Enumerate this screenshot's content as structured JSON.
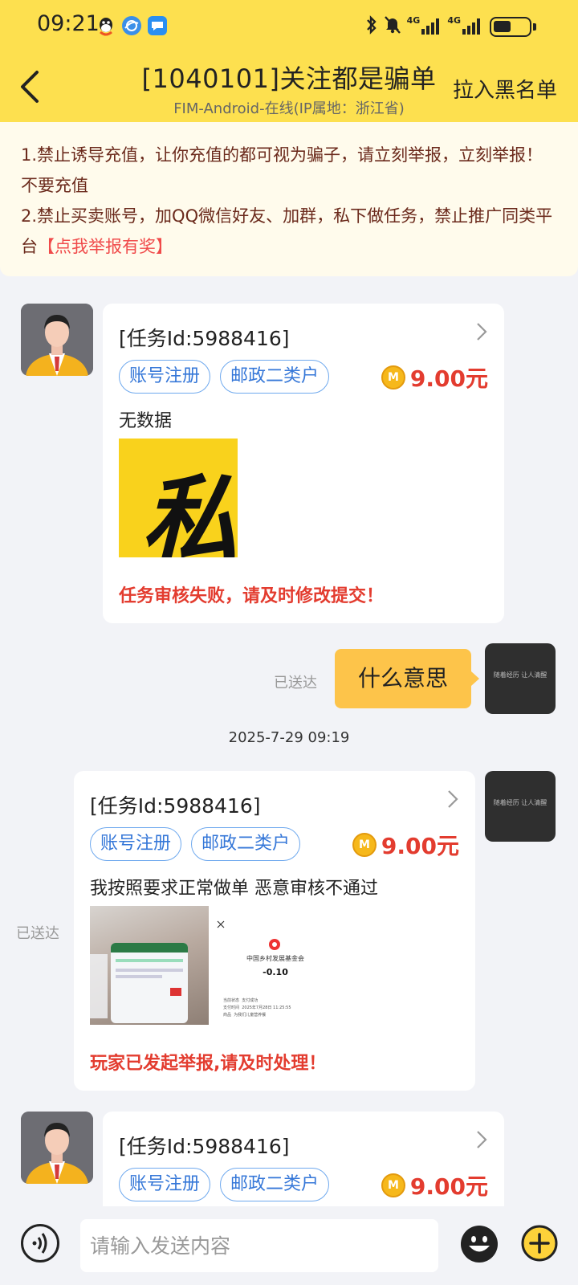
{
  "status_bar": {
    "time": "09:21",
    "network_label": "4G",
    "battery_level": 0.5,
    "icons": [
      "qq-icon",
      "browser-icon",
      "chat-app-icon",
      "bluetooth-icon",
      "mute-icon",
      "signal-icon",
      "battery-icon"
    ]
  },
  "header": {
    "title": "[1040101]关注都是骗单",
    "subtitle": "FIM-Android-在线(IP属地：浙江省)",
    "blacklist_label": "拉入黑名单"
  },
  "notice": {
    "line1": "1.禁止诱导充值，让你充值的都可视为骗子，请立刻举报，立刻举报！不要充值",
    "line2": "2.禁止买卖账号，加QQ微信好友、加群，私下做任务，禁止推广同类平台",
    "report_link": "【点我举报有奖】"
  },
  "messages": {
    "card1": {
      "task_id": "[任务Id:5988416]",
      "tags": [
        "账号注册",
        "邮政二类户"
      ],
      "coin_label": "M",
      "price": "9.00元",
      "desc": "无数据",
      "image_text": "私",
      "alert": "任务审核失败，请及时修改提交！"
    },
    "text_bubble": {
      "status": "已送达",
      "text": "什么意思",
      "avatar_text": "随着经历 让人清醒"
    },
    "timestamp": "2025-7-29 09:19",
    "card2": {
      "status": "已送达",
      "task_id": "[任务Id:5988416]",
      "tags": [
        "账号注册",
        "邮政二类户"
      ],
      "coin_label": "M",
      "price": "9.00元",
      "desc": "我按照要求正常做单 恶意审核不通过",
      "thumb2": {
        "title": "中国乡村发展基金会",
        "amount": "-0.10",
        "rows": [
          [
            "当前状态",
            "支付成功"
          ],
          [
            "支付时间",
            "2025年7月28日 11:25:55"
          ],
          [
            "商品",
            "为我们儿童营养餐"
          ]
        ]
      },
      "alert": "玩家已发起举报,请及时处理！",
      "avatar_text": "随着经历 让人清醒"
    },
    "card3": {
      "task_id": "[任务Id:5988416]",
      "tags": [
        "账号注册",
        "邮政二类户"
      ],
      "coin_label": "M",
      "price": "9.00元"
    }
  },
  "input_bar": {
    "placeholder": "请输入发送内容"
  }
}
